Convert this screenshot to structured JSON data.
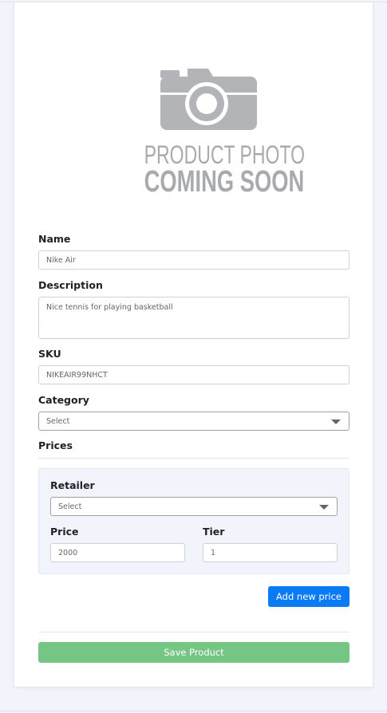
{
  "product_photo": {
    "line1": "PRODUCT PHOTO",
    "line2": "COMING SOON"
  },
  "form": {
    "name": {
      "label": "Name",
      "value": "Nike Air"
    },
    "description": {
      "label": "Description",
      "value": "Nice tennis for playing basketball"
    },
    "sku": {
      "label": "SKU",
      "value": "NIKEAIR99NHCT"
    },
    "category": {
      "label": "Category",
      "selected": "Select"
    },
    "prices_heading": "Prices"
  },
  "price_entry": {
    "retailer": {
      "label": "Retailer",
      "selected": "Select"
    },
    "price": {
      "label": "Price",
      "value": "2000"
    },
    "tier": {
      "label": "Tier",
      "value": "1"
    }
  },
  "buttons": {
    "add_price": "Add new price",
    "save_product": "Save Product"
  },
  "colors": {
    "page_background": "#f3f4fb",
    "primary_button": "#0a7bf5",
    "save_button": "#75c685",
    "price_panel": "#f1f4fb"
  }
}
